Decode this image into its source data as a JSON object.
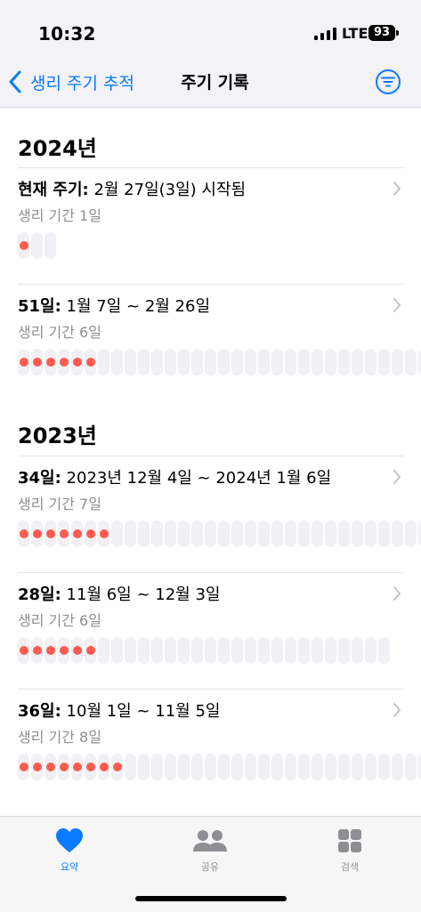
{
  "status": {
    "time": "10:32",
    "carrier": "LTE",
    "battery": "93"
  },
  "nav": {
    "back_label": "생리 주기 추적",
    "title": "주기 기록"
  },
  "years": [
    {
      "year": "2024년",
      "cycles": [
        {
          "length": "현재 주기:",
          "range": "2월 27일(3일) 시작됨",
          "period": "생리 기간 1일",
          "period_days": 1,
          "total_days": 3
        },
        {
          "length": "51일:",
          "range": "1월 7일 ~ 2월 26일",
          "period": "생리 기간 6일",
          "period_days": 6,
          "total_days": 51
        }
      ]
    },
    {
      "year": "2023년",
      "cycles": [
        {
          "length": "34일:",
          "range": "2023년 12월 4일 ~ 2024년 1월 6일",
          "period": "생리 기간 7일",
          "period_days": 7,
          "total_days": 34
        },
        {
          "length": "28일:",
          "range": "11월 6일 ~ 12월 3일",
          "period": "생리 기간 6일",
          "period_days": 6,
          "total_days": 28
        },
        {
          "length": "36일:",
          "range": "10월 1일 ~ 11월 5일",
          "period": "생리 기간 8일",
          "period_days": 8,
          "total_days": 36
        }
      ]
    }
  ],
  "tabs": [
    {
      "label": "요약",
      "icon": "heart-icon",
      "active": true
    },
    {
      "label": "공유",
      "icon": "people-icon",
      "active": false
    },
    {
      "label": "검색",
      "icon": "grid-icon",
      "active": false
    }
  ],
  "colors": {
    "accent": "#0a7aff",
    "period": "#ff5a4e",
    "day": "#f0f0f5"
  }
}
